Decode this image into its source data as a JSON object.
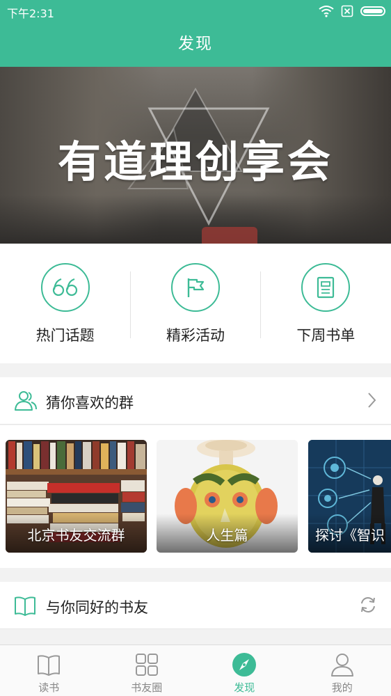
{
  "status_bar": {
    "time": "下午2:31"
  },
  "header": {
    "title": "发现"
  },
  "banner": {
    "title": "有道理创享会"
  },
  "quick_links": [
    {
      "label": "热门话题",
      "icon": "quote-icon"
    },
    {
      "label": "精彩活动",
      "icon": "flag-icon"
    },
    {
      "label": "下周书单",
      "icon": "document-icon"
    }
  ],
  "groups_section": {
    "title": "猜你喜欢的群",
    "icon": "people-icon",
    "cards": [
      {
        "label": "北京书友交流群"
      },
      {
        "label": "人生篇"
      },
      {
        "label": "探讨《智识"
      }
    ]
  },
  "friends_section": {
    "title": "与你同好的书友",
    "icon": "book-icon"
  },
  "tabbar": {
    "items": [
      {
        "label": "读书",
        "icon": "book-tab-icon",
        "active": false
      },
      {
        "label": "书友圈",
        "icon": "grid-icon",
        "active": false
      },
      {
        "label": "发现",
        "icon": "compass-icon",
        "active": true
      },
      {
        "label": "我的",
        "icon": "person-icon",
        "active": false
      }
    ]
  },
  "colors": {
    "accent": "#3dbb96",
    "text": "#222222",
    "muted": "#888888"
  }
}
